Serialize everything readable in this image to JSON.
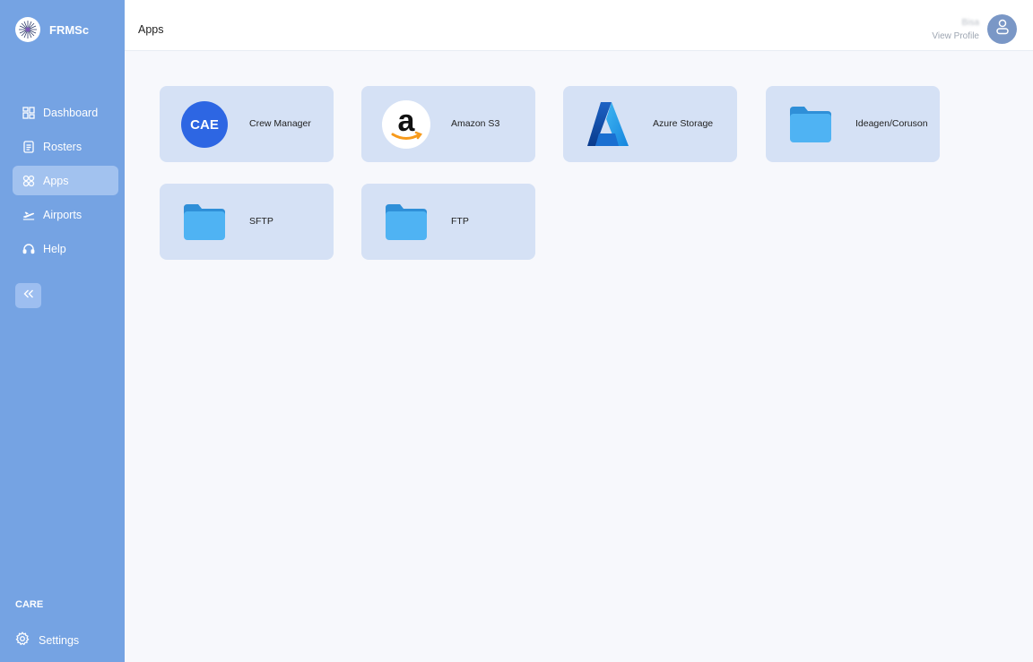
{
  "brand": {
    "name": "FRMSc"
  },
  "sidebar": {
    "items": [
      {
        "label": "Dashboard",
        "icon": "dashboard-icon",
        "active": false
      },
      {
        "label": "Rosters",
        "icon": "document-icon",
        "active": false
      },
      {
        "label": "Apps",
        "icon": "apps-icon",
        "active": true
      },
      {
        "label": "Airports",
        "icon": "airplane-icon",
        "active": false
      },
      {
        "label": "Help",
        "icon": "headset-icon",
        "active": false
      }
    ],
    "section_label": "CARE",
    "settings_label": "Settings"
  },
  "header": {
    "title": "Apps",
    "profile_name": "Bisa",
    "profile_link": "View Profile"
  },
  "apps": [
    {
      "label": "Crew Manager",
      "icon": "cae-logo",
      "icon_text": "CAE"
    },
    {
      "label": "Amazon S3",
      "icon": "amazon-logo",
      "icon_text": "a"
    },
    {
      "label": "Azure Storage",
      "icon": "azure-logo"
    },
    {
      "label": "Ideagen/Coruson",
      "icon": "folder-icon"
    },
    {
      "label": "SFTP",
      "icon": "folder-icon"
    },
    {
      "label": "FTP",
      "icon": "folder-icon"
    }
  ],
  "colors": {
    "sidebar": "#75a3e3",
    "card": "#d5e1f5",
    "main_bg": "#f7f8fc",
    "cae_blue": "#2d66e3",
    "folder_blue": "#41a9ee"
  }
}
